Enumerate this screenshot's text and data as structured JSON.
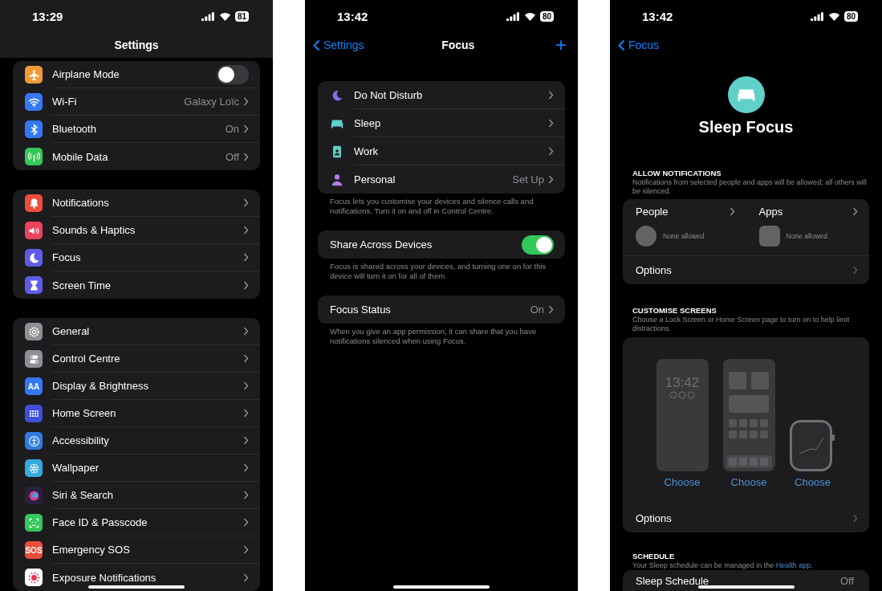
{
  "settings_screen": {
    "status": {
      "time": "13:29",
      "battery": "81"
    },
    "title": "Settings",
    "groups": [
      {
        "rows": [
          {
            "label": "Airplane Mode",
            "kind": "toggle",
            "on": false,
            "color": "#f19a37"
          },
          {
            "label": "Wi-Fi",
            "kind": "link",
            "value": "Galaxy Loïc",
            "color": "#3478f6"
          },
          {
            "label": "Bluetooth",
            "kind": "link",
            "value": "On",
            "color": "#3478f6"
          },
          {
            "label": "Mobile Data",
            "kind": "link",
            "value": "Off",
            "color": "#34c759"
          }
        ]
      },
      {
        "rows": [
          {
            "label": "Notifications",
            "kind": "link",
            "color": "#eb4e3d"
          },
          {
            "label": "Sounds & Haptics",
            "kind": "link",
            "color": "#eb445a"
          },
          {
            "label": "Focus",
            "kind": "link",
            "color": "#5e5ce6"
          },
          {
            "label": "Screen Time",
            "kind": "link",
            "color": "#5e5ce6"
          }
        ]
      },
      {
        "rows": [
          {
            "label": "General",
            "kind": "link",
            "color": "#8e8e93"
          },
          {
            "label": "Control Centre",
            "kind": "link",
            "color": "#8e8e93"
          },
          {
            "label": "Display & Brightness",
            "kind": "link",
            "color": "#3478f6",
            "icon_text": "AA"
          },
          {
            "label": "Home Screen",
            "kind": "link",
            "color": "#3f4fd9"
          },
          {
            "label": "Accessibility",
            "kind": "link",
            "color": "#2f7ce0"
          },
          {
            "label": "Wallpaper",
            "kind": "link",
            "color": "#36aadc"
          },
          {
            "label": "Siri & Search",
            "kind": "link",
            "color": "#2a2140"
          },
          {
            "label": "Face ID & Passcode",
            "kind": "link",
            "color": "#34c759"
          },
          {
            "label": "Emergency SOS",
            "kind": "link",
            "color": "#eb4e3d",
            "icon_text": "SOS"
          },
          {
            "label": "Exposure Notifications",
            "kind": "link",
            "color": "#ffffff"
          }
        ]
      }
    ]
  },
  "focus_screen": {
    "status": {
      "time": "13:42",
      "battery": "80"
    },
    "back": "Settings",
    "title": "Focus",
    "add": "+",
    "modes": [
      {
        "label": "Do Not Disturb",
        "color": "#7d72e8"
      },
      {
        "label": "Sleep",
        "color": "#5fd1c9"
      },
      {
        "label": "Work",
        "color": "#5fd1c9"
      },
      {
        "label": "Personal",
        "color": "#b47ee5",
        "value": "Set Up"
      }
    ],
    "modes_footer": "Focus lets you customise your devices and silence calls and notifications. Turn it on and off in Control Centre.",
    "share": {
      "label": "Share Across Devices",
      "on": true
    },
    "share_footer": "Focus is shared across your devices, and turning one on for this device will turn it on for all of them.",
    "status_row": {
      "label": "Focus Status",
      "value": "On"
    },
    "status_footer": "When you give an app permission, it can share that you have notifications silenced when using Focus."
  },
  "sleep_focus_screen": {
    "status": {
      "time": "13:42",
      "battery": "80"
    },
    "back": "Focus",
    "title": "Sleep Focus",
    "allow": {
      "header": "ALLOW NOTIFICATIONS",
      "description": "Notifications from selected people and apps will be allowed; all others will be silenced.",
      "columns": [
        {
          "label": "People",
          "kind": "people",
          "summary": "None allowed"
        },
        {
          "label": "Apps",
          "kind": "apps",
          "summary": "None allowed"
        }
      ],
      "options": "Options"
    },
    "customise": {
      "header": "CUSTOMISE SCREENS",
      "description": "Choose a Lock Screen or Home Screen page to turn on to help limit distractions.",
      "screens": [
        {
          "kind": "lock",
          "time": "13:42",
          "action": "Choose"
        },
        {
          "kind": "home",
          "action": "Choose"
        },
        {
          "kind": "watch",
          "action": "Choose"
        }
      ],
      "options": "Options"
    },
    "schedule": {
      "header": "SCHEDULE",
      "description": "Your Sleep schedule can be managed in the",
      "link": "Health app.",
      "row": {
        "label": "Sleep Schedule",
        "value": "Off"
      }
    }
  }
}
